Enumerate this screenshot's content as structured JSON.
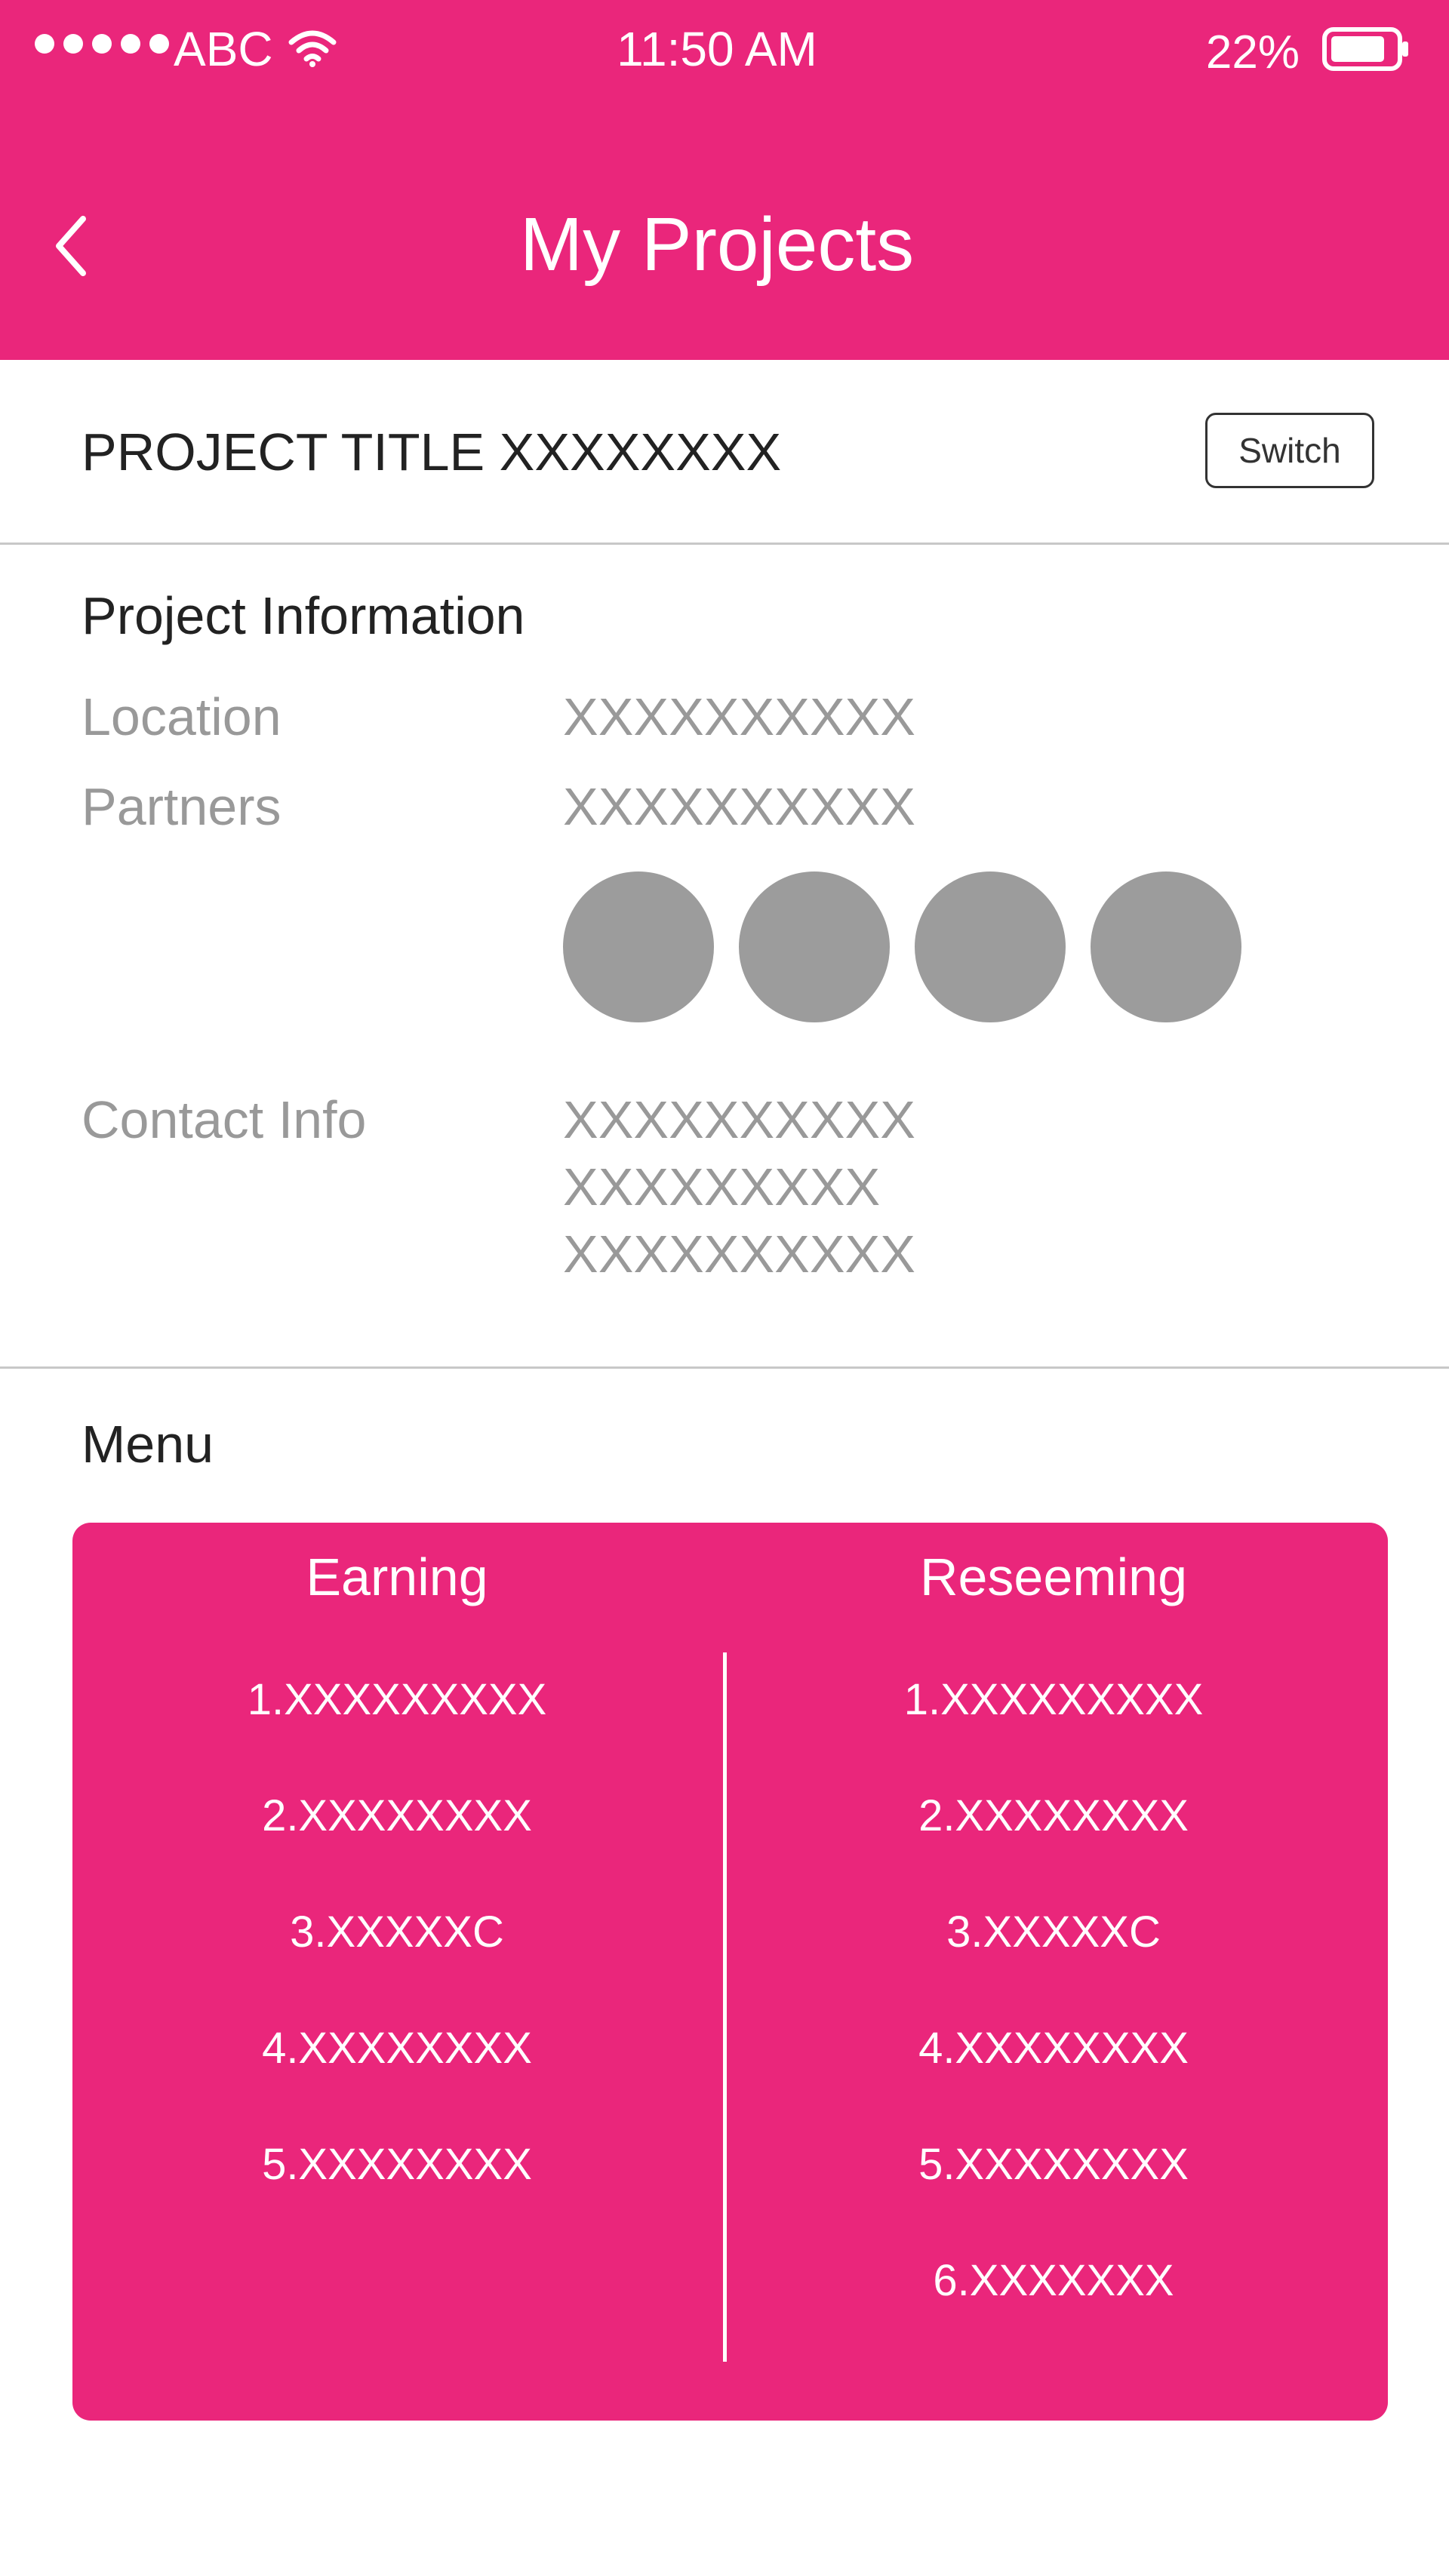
{
  "status_bar": {
    "carrier": "ABC",
    "time": "11:50 AM",
    "battery_percent": "22%",
    "battery_level": 0.22,
    "signal_icon": "signal-dots-icon",
    "wifi_icon": "wifi-icon",
    "battery_icon": "battery-icon"
  },
  "nav": {
    "title": "My Projects",
    "back_icon": "chevron-left-icon"
  },
  "project": {
    "title": "PROJECT TITLE XXXXXXXX",
    "switch_label": "Switch"
  },
  "info": {
    "heading": "Project Information",
    "location_label": "Location",
    "location_value": "XXXXXXXXXX",
    "partners_label": "Partners",
    "partners_value": "XXXXXXXXXX",
    "partner_avatar_count": 4,
    "contact_label": "Contact Info",
    "contact_values": [
      "XXXXXXXXXX",
      "XXXXXXXXX",
      "XXXXXXXXXX"
    ]
  },
  "menu": {
    "heading": "Menu",
    "earning": {
      "title": "Earning",
      "items": [
        "1.XXXXXXXXX",
        "2.XXXXXXXX",
        "3.XXXXXC",
        "4.XXXXXXXX",
        "5.XXXXXXXX"
      ]
    },
    "redeeming": {
      "title": "Reseeming",
      "items": [
        "1.XXXXXXXXX",
        "2.XXXXXXXX",
        "3.XXXXXC",
        "4.XXXXXXXX",
        "5.XXXXXXXX",
        "6.XXXXXXX"
      ]
    }
  },
  "colors": {
    "accent": "#ea267b",
    "muted_text": "#999999",
    "avatar": "#9c9c9c",
    "divider": "#c8c8c8"
  }
}
